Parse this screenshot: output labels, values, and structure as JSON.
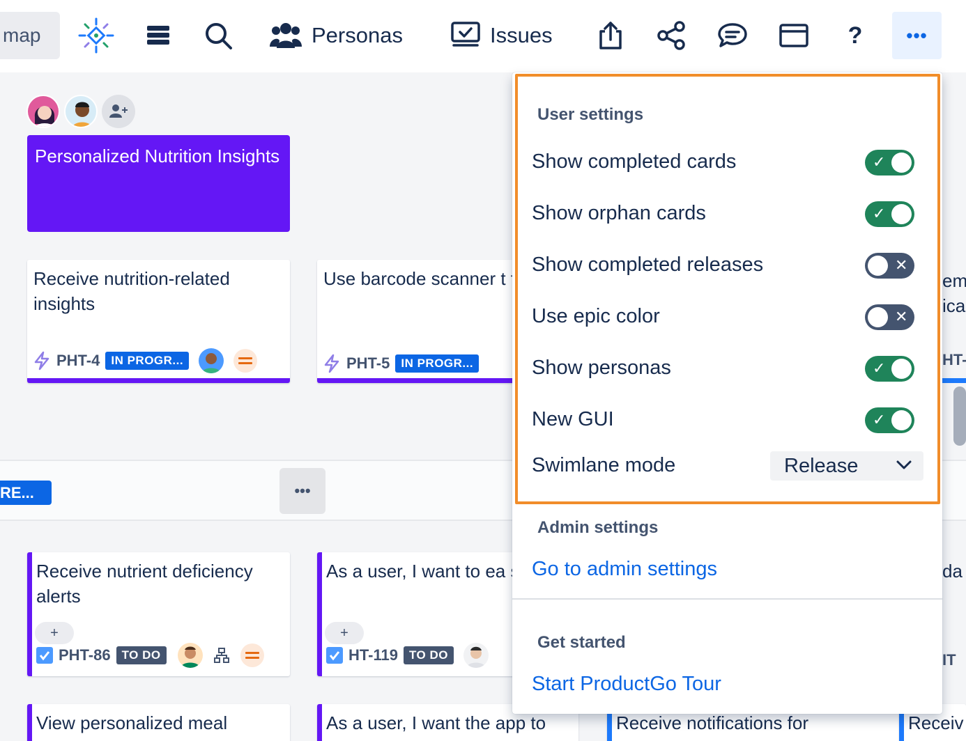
{
  "topbar": {
    "map_tab_label": "map",
    "personas_label": "Personas",
    "issues_label": "Issues",
    "more_label": "•••",
    "colors": {
      "brand_blue": "#0c66e4",
      "more_bg": "#e9f2ff"
    }
  },
  "board": {
    "epic_title": "Personalized Nutrition Insights",
    "epic_color": "#6417f5",
    "cards_row1": [
      {
        "title": "Receive nutrition-related insights",
        "key": "PHT-4",
        "status": "IN PROGR..."
      },
      {
        "title": "Use barcode scanner t food items",
        "key": "PHT-5",
        "status": "IN PROGR..."
      }
    ],
    "release_chip": "RE...",
    "lane_more": "•••",
    "cards_row2": [
      {
        "title": "Receive nutrient deficiency alerts",
        "key": "PHT-86",
        "status": "TO DO",
        "plus": "+"
      },
      {
        "title": "As a user, I want to ea scan barcodes of food to add them to my nut",
        "key": "HT-119",
        "status": "TO DO",
        "plus": "+"
      }
    ],
    "cards_row3": [
      {
        "title": "View personalized meal"
      },
      {
        "title": "As a user, I want the app to"
      },
      {
        "title": "Receive notifications for"
      },
      {
        "title": "Receiv"
      }
    ],
    "partial_right": {
      "line1": "em",
      "line2": "ica",
      "key_frag": "HT-",
      "row2_frag": "da",
      "row2_key": "IT"
    }
  },
  "menu": {
    "user_settings_heading": "User settings",
    "settings": [
      {
        "label": "Show completed cards",
        "state": "on",
        "mark": "✓"
      },
      {
        "label": "Show orphan cards",
        "state": "on",
        "mark": "✓"
      },
      {
        "label": "Show completed releases",
        "state": "off",
        "mark": "✕"
      },
      {
        "label": "Use epic color",
        "state": "off",
        "mark": "✕"
      },
      {
        "label": "Show personas",
        "state": "on",
        "mark": "✓"
      },
      {
        "label": "New GUI",
        "state": "on",
        "mark": "✓"
      }
    ],
    "swimlane_label": "Swimlane mode",
    "swimlane_value": "Release",
    "admin_heading": "Admin settings",
    "admin_link": "Go to admin settings",
    "started_heading": "Get started",
    "tour_link": "Start ProductGo Tour",
    "colors": {
      "toggle_on": "#1f845a",
      "toggle_off": "#44546f",
      "highlight": "#f18d2a"
    }
  }
}
